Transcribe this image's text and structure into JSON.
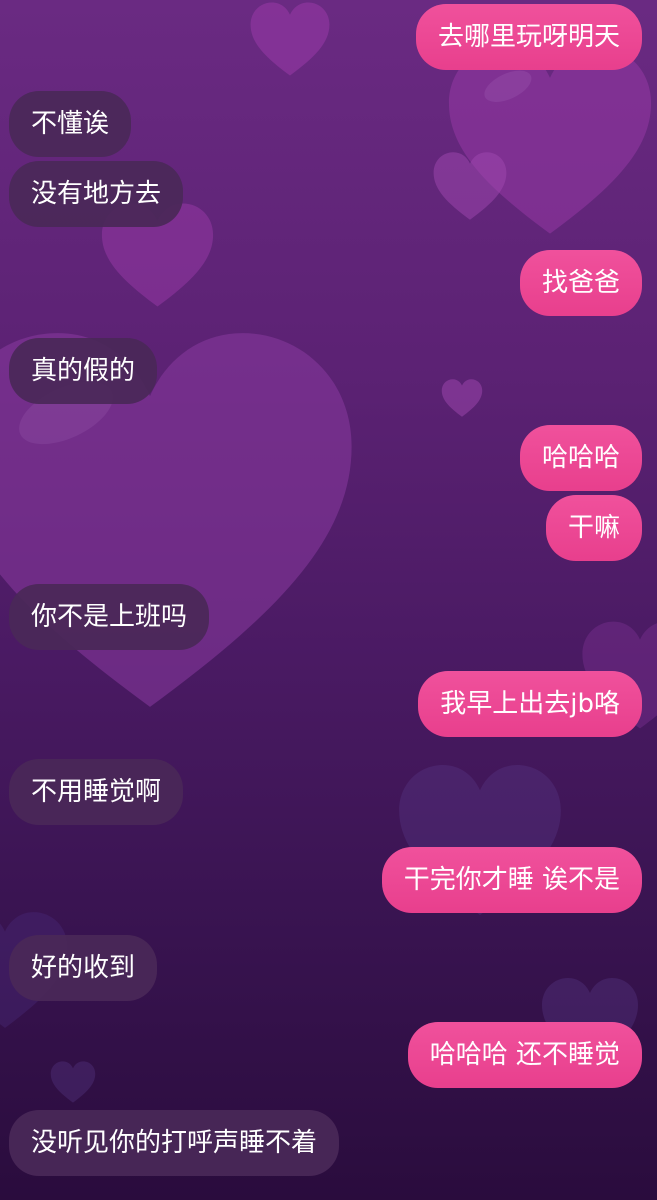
{
  "background": {
    "colors": {
      "top": "#6a2a82",
      "middle": "#4a1a63",
      "bottom": "#2a0c3d",
      "heart": "#8a3aa0"
    },
    "icon": "heart-icon"
  },
  "bubble_colors": {
    "incoming": "#4a2858",
    "outgoing": "#ec4894",
    "text": "#ffffff"
  },
  "messages": [
    {
      "side": "out",
      "text": "去哪里玩呀明天"
    },
    {
      "side": "in",
      "text": "不懂诶"
    },
    {
      "side": "in",
      "text": "没有地方去"
    },
    {
      "side": "out",
      "text": "找爸爸"
    },
    {
      "side": "in",
      "text": "真的假的"
    },
    {
      "side": "out",
      "text": "哈哈哈"
    },
    {
      "side": "out",
      "text": "干嘛"
    },
    {
      "side": "in",
      "text": "你不是上班吗"
    },
    {
      "side": "out",
      "text": "我早上出去jb咯"
    },
    {
      "side": "in",
      "text": "不用睡觉啊"
    },
    {
      "side": "out",
      "text": "干完你才睡 诶不是"
    },
    {
      "side": "in",
      "text": "好的收到"
    },
    {
      "side": "out",
      "text": "哈哈哈 还不睡觉"
    },
    {
      "side": "in",
      "text": "没听见你的打呼声睡不着"
    }
  ]
}
